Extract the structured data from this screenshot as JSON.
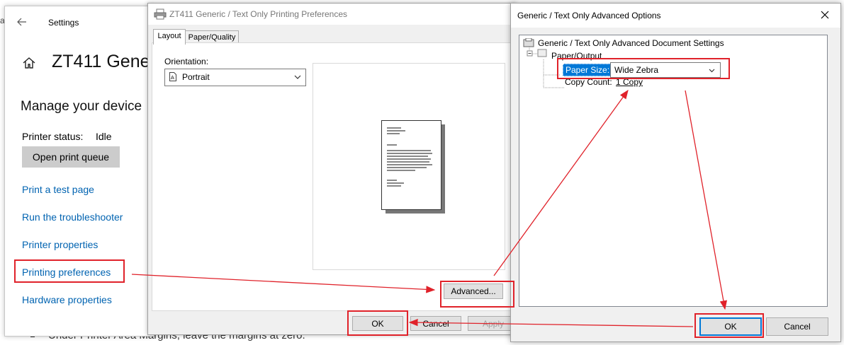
{
  "background": {
    "edge_letter": "a",
    "instruction": "Under Printer Area Margins, leave the margins at zero."
  },
  "settings": {
    "title": "Settings",
    "heading": "ZT411 Gene",
    "manage": "Manage your device",
    "printer_status_label": "Printer status:",
    "printer_status_value": "Idle",
    "open_queue_label": "Open print queue",
    "links": {
      "test_page": "Print a test page",
      "troubleshooter": "Run the troubleshooter",
      "printer_properties": "Printer properties",
      "printing_preferences": "Printing preferences",
      "hardware_properties": "Hardware properties"
    }
  },
  "preferences": {
    "title": "ZT411 Generic / Text Only Printing Preferences",
    "tabs": [
      "Layout",
      "Paper/Quality"
    ],
    "orientation_label": "Orientation:",
    "orientation_value": "Portrait",
    "advanced_label": "Advanced...",
    "ok_label": "OK",
    "cancel_label": "Cancel",
    "apply_label": "Apply"
  },
  "advanced": {
    "title": "Generic / Text Only Advanced Options",
    "root": "Generic / Text Only Advanced Document Settings",
    "paper_output": "Paper/Output",
    "paper_size_label": "Paper Size:",
    "paper_size_value": "Wide Zebra",
    "copy_count_label": "Copy Count:",
    "copy_count_value": "1 Copy",
    "ok_label": "OK",
    "cancel_label": "Cancel"
  },
  "colors": {
    "link": "#0063b1",
    "highlight": "#e0222a",
    "selection": "#0078d7"
  }
}
